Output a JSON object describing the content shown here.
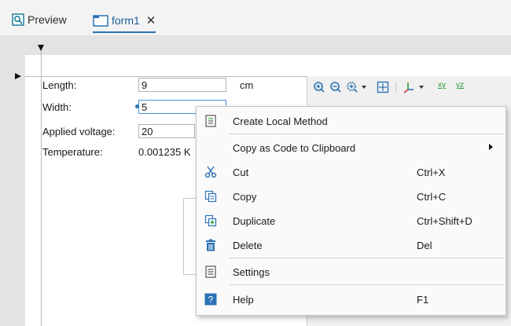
{
  "tabs": [
    {
      "label": "Preview"
    },
    {
      "label": "form1",
      "close": "✕"
    }
  ],
  "form": {
    "length_label": "Length:",
    "length_value": "9",
    "length_unit": "cm",
    "width_label": "Width:",
    "width_value": "5",
    "voltage_label": "Applied voltage:",
    "voltage_value": "20",
    "temperature_label": "Temperature:",
    "temperature_value": "0.001235 K"
  },
  "graph_toolbar": {
    "axis_xy": "xy",
    "axis_yz": "yz"
  },
  "context_menu": {
    "items": [
      {
        "label": "Create Local Method",
        "shortcut": "",
        "icon": "method-icon"
      },
      {
        "label": "Copy as Code to Clipboard",
        "shortcut": "",
        "icon": "",
        "submenu": true
      },
      {
        "label": "Cut",
        "shortcut": "Ctrl+X",
        "icon": "scissors-icon"
      },
      {
        "label": "Copy",
        "shortcut": "Ctrl+C",
        "icon": "copy-icon"
      },
      {
        "label": "Duplicate",
        "shortcut": "Ctrl+Shift+D",
        "icon": "duplicate-icon"
      },
      {
        "label": "Delete",
        "shortcut": "Del",
        "icon": "trash-icon"
      },
      {
        "label": "Settings",
        "shortcut": "",
        "icon": "settings-icon"
      },
      {
        "label": "Help",
        "shortcut": "F1",
        "icon": "help-icon"
      }
    ]
  },
  "colors": {
    "accent": "#2a72b5",
    "menu_bg": "#fafafa",
    "canvas_bg": "#e3e3e3"
  }
}
